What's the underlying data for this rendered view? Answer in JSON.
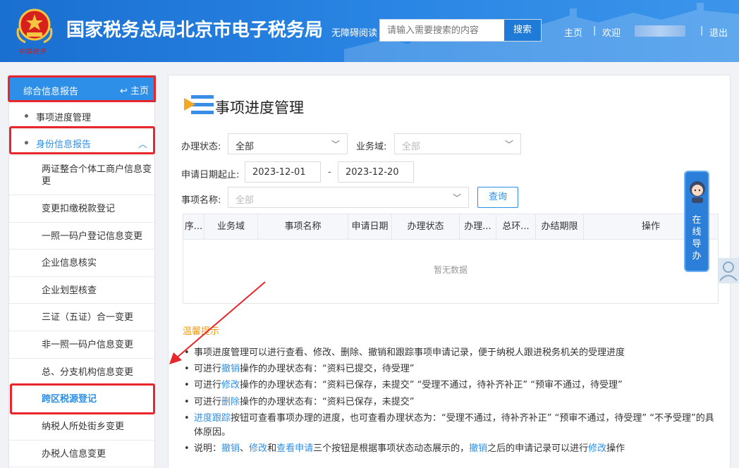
{
  "header": {
    "title": "国家税务总局北京市电子税务局",
    "emblem_signature": "中国税务",
    "accessibility": "无障碍阅读",
    "search_placeholder": "请输入需要搜索的内容",
    "search_button": "搜索",
    "nav_home": "主页",
    "sep1": "|",
    "welcome": "欢迎",
    "sep2": "|",
    "logout": "退出"
  },
  "sidebar": {
    "header_label": "综合信息报告",
    "home_link": "主页",
    "items": [
      {
        "label": "事项进度管理"
      },
      {
        "label": "身份信息报告"
      }
    ],
    "sub_items": [
      {
        "label": "两证整合个体工商户信息变更"
      },
      {
        "label": "变更扣缴税款登记"
      },
      {
        "label": "一照一码户登记信息变更"
      },
      {
        "label": "企业信息核实"
      },
      {
        "label": "企业划型核查"
      },
      {
        "label": "三证（五证）合一变更"
      },
      {
        "label": "非一照一码户信息变更"
      },
      {
        "label": "总、分支机构信息变更"
      },
      {
        "label": "跨区税源登记"
      },
      {
        "label": "纳税人所处街乡变更"
      },
      {
        "label": "办税人信息变更"
      }
    ]
  },
  "main": {
    "title": "事项进度管理",
    "filters": {
      "status_label": "办理状态:",
      "status_value": "全部",
      "domain_label": "业务域:",
      "domain_placeholder": "全部",
      "date_label": "申请日期起止:",
      "date_start": "2023-12-01",
      "date_sep": "-",
      "date_end": "2023-12-20",
      "name_label": "事项名称:",
      "name_placeholder": "全部",
      "query_button": "查询"
    },
    "table": {
      "columns": [
        "序...",
        "业务域",
        "事项名称",
        "申请日期",
        "办理状态",
        "办理...",
        "总环...",
        "办结期限",
        "操作"
      ],
      "empty_text": "暂无数据"
    },
    "tips": {
      "title": "温馨提示",
      "line1": "事项进度管理可以进行查看、修改、删除、撤销和跟踪事项申请记录，便于纳税人跟进税务机关的受理进度",
      "line2_pre": "可进行",
      "line2_link": "撤销",
      "line2_post": "操作的办理状态有：“资料已提交，待受理”",
      "line3_pre": "可进行",
      "line3_link": "修改",
      "line3_post": "操作的办理状态有：“资料已保存，未提交”  “受理不通过，待补齐补正”  “预审不通过，待受理”",
      "line4_pre": "可进行",
      "line4_link": "删除",
      "line4_post": "操作的办理状态有：“资料已保存，未提交”",
      "line5_link": "进度跟踪",
      "line5_post": "按钮可查看事项办理的进度，也可查看办理状态为：“受理不通过，待补齐补正”  “预审不通过，待受理”  “不予受理”的具体原因。",
      "line6_pre": "说明：",
      "line6_link1": "撤销",
      "line6_mid1": "、",
      "line6_link2": "修改",
      "line6_mid2": "和",
      "line6_link3": "查看申请",
      "line6_mid3": "三个按钮是根据事项状态动态展示的，",
      "line6_link4": "撤销",
      "line6_mid4": "之后的申请记录可以进行",
      "line6_link5": "修改",
      "line6_end": "操作"
    }
  },
  "float_widget": {
    "label": "在线导办"
  },
  "colors": {
    "header_blue": "#2a86e4",
    "accent": "#2e8fe8",
    "tips_orange": "#f39c12",
    "highlight_red": "#e8262b"
  }
}
